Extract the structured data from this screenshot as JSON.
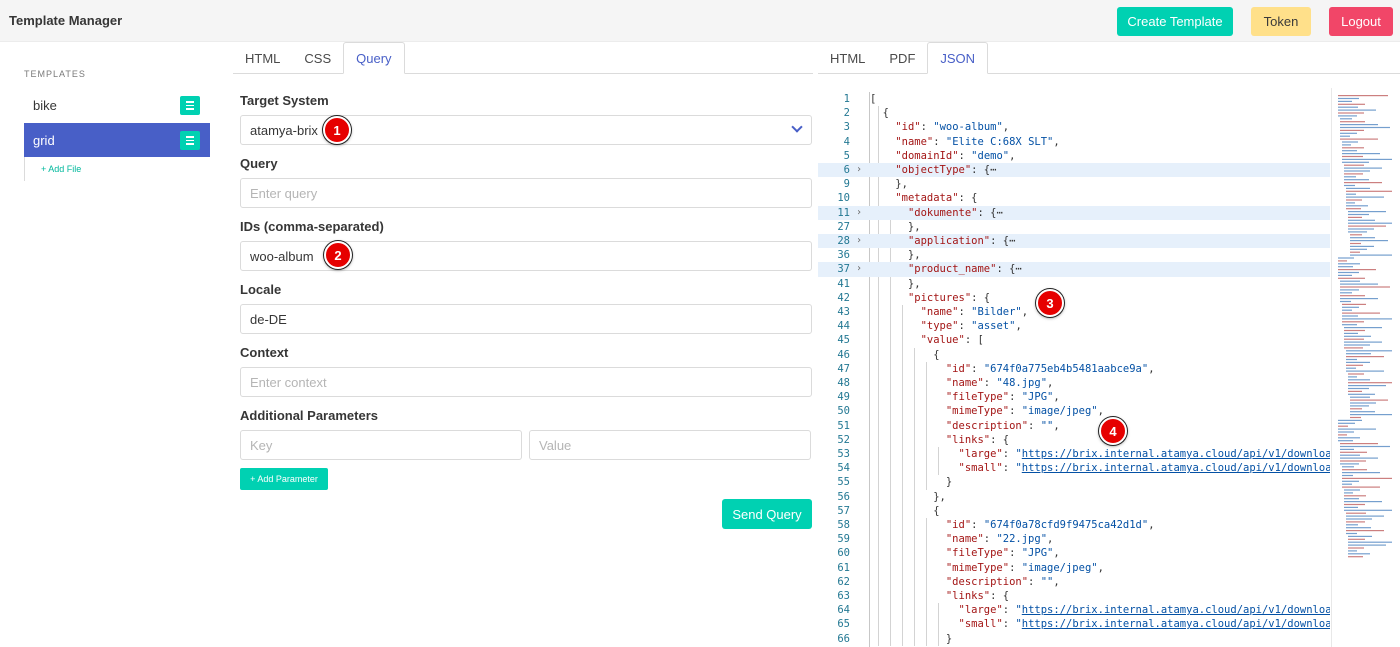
{
  "header": {
    "title": "Template Manager",
    "create_label": "Create Template",
    "token_label": "Token",
    "logout_label": "Logout"
  },
  "sidebar": {
    "heading": "TEMPLATES",
    "items": [
      {
        "label": "bike",
        "active": false
      },
      {
        "label": "grid",
        "active": true
      }
    ],
    "add_file": "+ Add File"
  },
  "left_tabs": [
    "HTML",
    "CSS",
    "Query"
  ],
  "left_active_tab": "Query",
  "right_tabs": [
    "HTML",
    "PDF",
    "JSON"
  ],
  "right_active_tab": "JSON",
  "form": {
    "target_system_label": "Target System",
    "target_system_value": "atamya-brix",
    "query_label": "Query",
    "query_placeholder": "Enter query",
    "ids_label": "IDs (comma-separated)",
    "ids_value": "woo-album",
    "locale_label": "Locale",
    "locale_value": "de-DE",
    "context_label": "Context",
    "context_placeholder": "Enter context",
    "additional_label": "Additional Parameters",
    "key_placeholder": "Key",
    "value_placeholder": "Value",
    "add_param_label": "+ Add Parameter",
    "send_label": "Send Query"
  },
  "markers": [
    "1",
    "2",
    "3",
    "4"
  ],
  "colors": {
    "primary": "#00d1b2",
    "link": "#485fc7",
    "warning": "#ffe08a",
    "danger": "#f14668",
    "marker": "#e60000"
  },
  "editor": {
    "lines": [
      {
        "n": "1",
        "t": "["
      },
      {
        "n": "2",
        "t": "  {"
      },
      {
        "n": "3",
        "t": "    \"id\": \"woo-album\","
      },
      {
        "n": "4",
        "t": "    \"name\": \"Elite C:68X SLT\","
      },
      {
        "n": "5",
        "t": "    \"domainId\": \"demo\","
      },
      {
        "n": "6",
        "t": "    \"objectType\": {⋯",
        "fold": true,
        "hl": true
      },
      {
        "n": "9",
        "t": "    },"
      },
      {
        "n": "10",
        "t": "    \"metadata\": {"
      },
      {
        "n": "11",
        "t": "      \"dokumente\": {⋯",
        "fold": true,
        "hl": true
      },
      {
        "n": "27",
        "t": "      },"
      },
      {
        "n": "28",
        "t": "      \"application\": {⋯",
        "fold": true,
        "hl": true
      },
      {
        "n": "36",
        "t": "      },"
      },
      {
        "n": "37",
        "t": "      \"product_name\": {⋯",
        "fold": true,
        "hl": true
      },
      {
        "n": "41",
        "t": "      },"
      },
      {
        "n": "42",
        "t": "      \"pictures\": {"
      },
      {
        "n": "43",
        "t": "        \"name\": \"Bilder\","
      },
      {
        "n": "44",
        "t": "        \"type\": \"asset\","
      },
      {
        "n": "45",
        "t": "        \"value\": ["
      },
      {
        "n": "46",
        "t": "          {"
      },
      {
        "n": "47",
        "t": "            \"id\": \"674f0a775eb4b5481aabce9a\","
      },
      {
        "n": "48",
        "t": "            \"name\": \"48.jpg\","
      },
      {
        "n": "49",
        "t": "            \"fileType\": \"JPG\","
      },
      {
        "n": "50",
        "t": "            \"mimeType\": \"image/jpeg\","
      },
      {
        "n": "51",
        "t": "            \"description\": \"\","
      },
      {
        "n": "52",
        "t": "            \"links\": {"
      },
      {
        "n": "53",
        "t": "              \"large\": \"https://brix.internal.atamya.cloud/api/v1/downloa"
      },
      {
        "n": "54",
        "t": "              \"small\": \"https://brix.internal.atamya.cloud/api/v1/downloa"
      },
      {
        "n": "55",
        "t": "            }"
      },
      {
        "n": "56",
        "t": "          },"
      },
      {
        "n": "57",
        "t": "          {"
      },
      {
        "n": "58",
        "t": "            \"id\": \"674f0a78cfd9f9475ca42d1d\","
      },
      {
        "n": "59",
        "t": "            \"name\": \"22.jpg\","
      },
      {
        "n": "60",
        "t": "            \"fileType\": \"JPG\","
      },
      {
        "n": "61",
        "t": "            \"mimeType\": \"image/jpeg\","
      },
      {
        "n": "62",
        "t": "            \"description\": \"\","
      },
      {
        "n": "63",
        "t": "            \"links\": {"
      },
      {
        "n": "64",
        "t": "              \"large\": \"https://brix.internal.atamya.cloud/api/v1/downloa"
      },
      {
        "n": "65",
        "t": "              \"small\": \"https://brix.internal.atamya.cloud/api/v1/downloa"
      },
      {
        "n": "66",
        "t": "            }"
      }
    ]
  }
}
